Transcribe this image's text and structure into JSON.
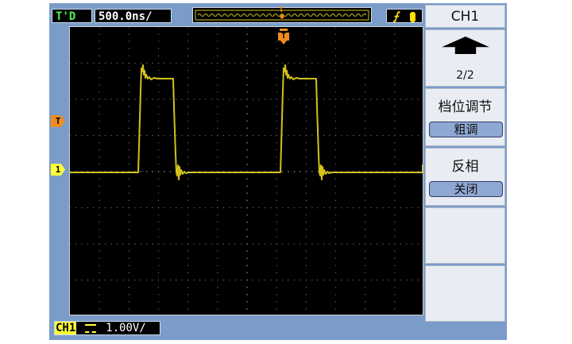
{
  "status_bar": {
    "trigger_status": "T'D",
    "timebase": "500.0ns/",
    "trigger_position_marker": "T",
    "trigger_type_symbol": "⨍"
  },
  "screen": {
    "trigger_marker": "T",
    "trigger_level_marker": "T",
    "channel_marker": "1"
  },
  "bottom_bar": {
    "channel_label": "CH1",
    "coupling_symbol": "DC",
    "vertical_scale": "1.00V/"
  },
  "menu": {
    "title": "CH1",
    "page": "2/2",
    "vertical_label": "档位调节",
    "vertical_value": "粗调",
    "invert_label": "反相",
    "invert_value": "关闭"
  },
  "colors": {
    "trace": "#d2c21a",
    "trigger": "#f08c1e",
    "frame": "#7b9cc9",
    "screen": "#000000"
  }
}
